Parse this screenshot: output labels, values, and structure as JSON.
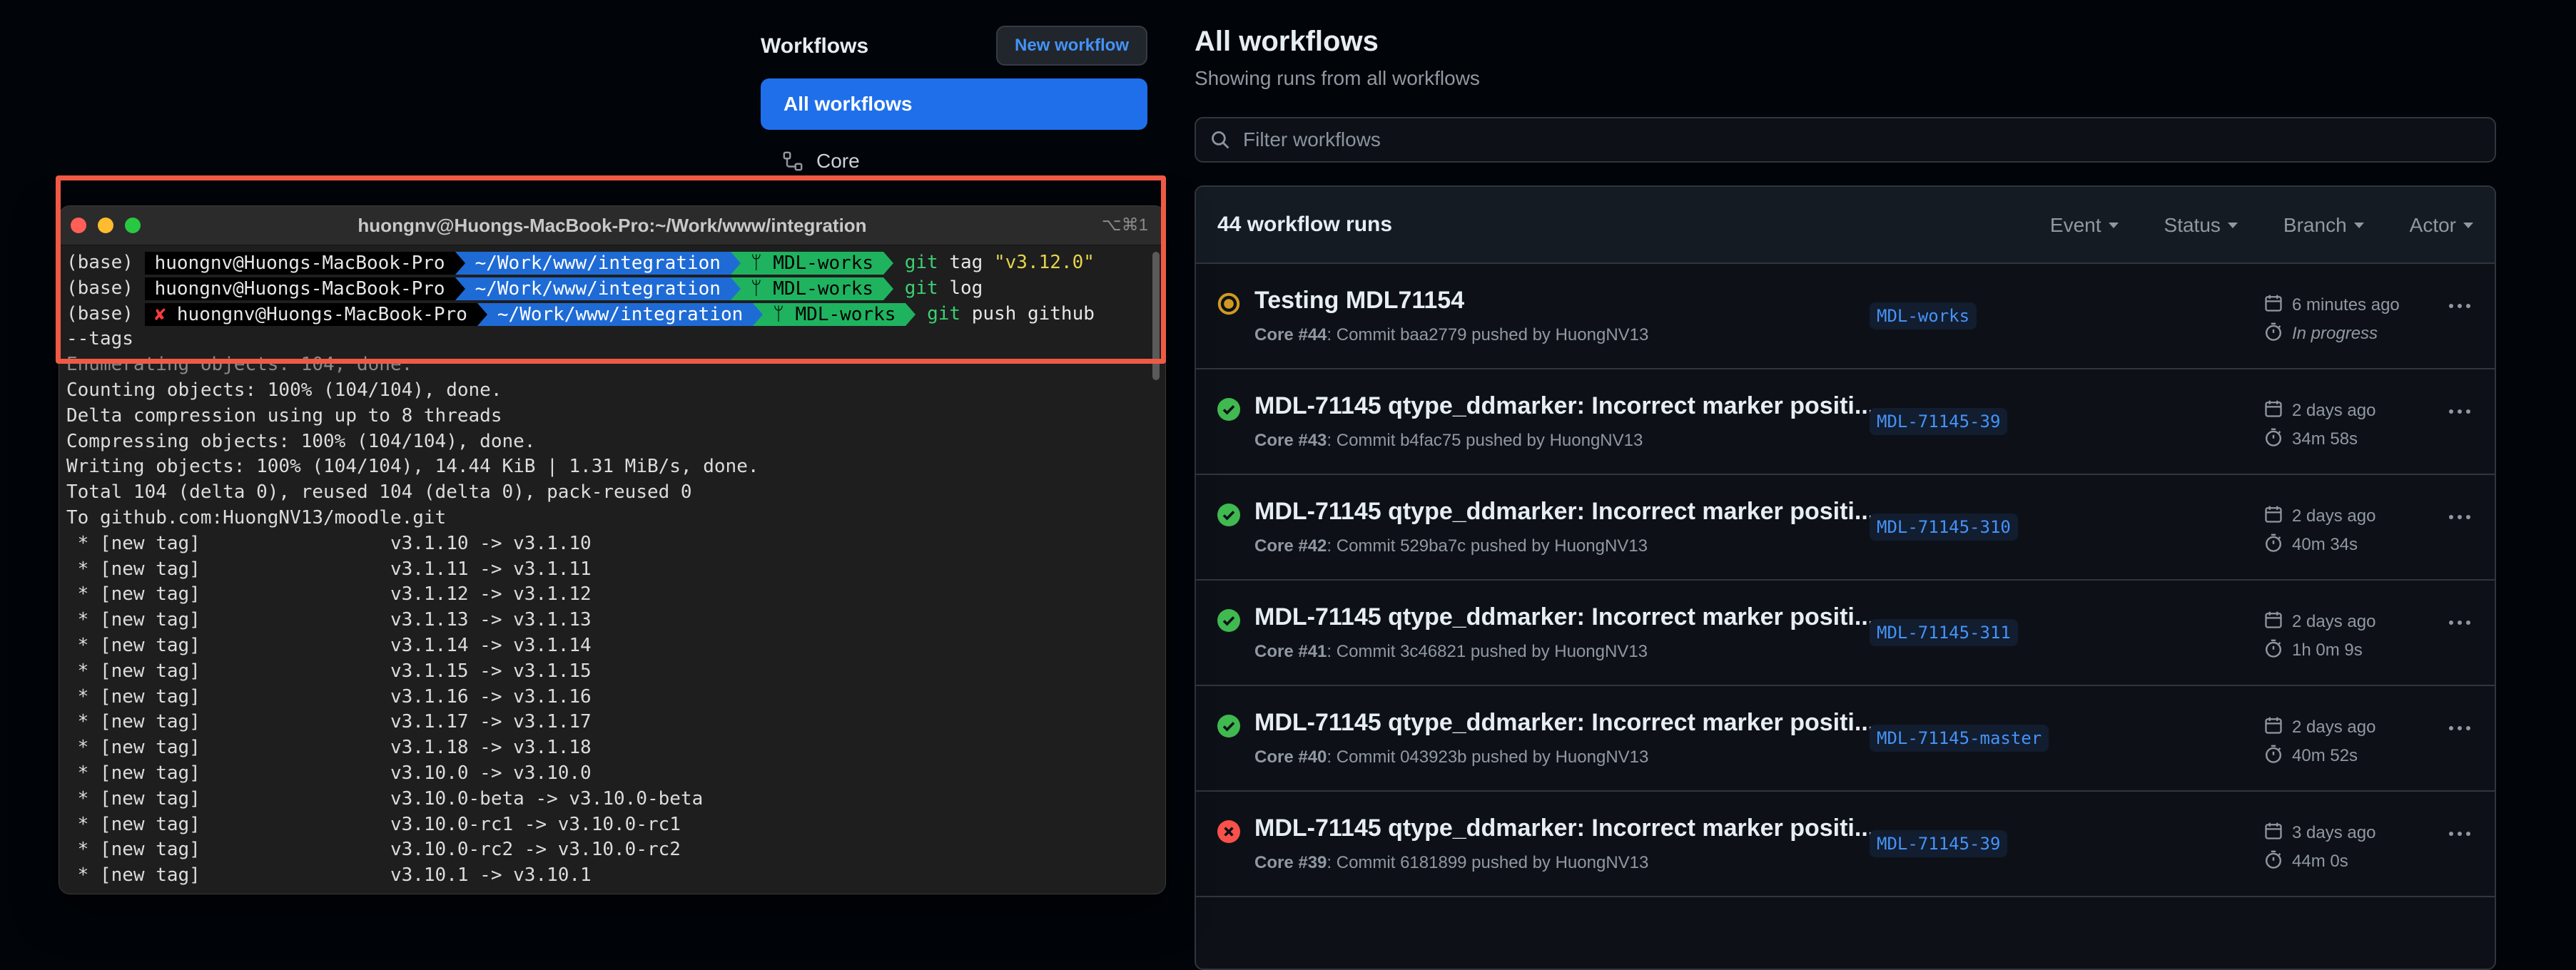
{
  "sidebar": {
    "title": "Workflows",
    "new_button": "New workflow",
    "items": [
      {
        "label": "All workflows"
      },
      {
        "label": "Core"
      }
    ]
  },
  "main": {
    "title": "All workflows",
    "subtitle": "Showing runs from all workflows",
    "filter_placeholder": "Filter workflows",
    "runs_count": "44 workflow runs",
    "filters": [
      "Event",
      "Status",
      "Branch",
      "Actor"
    ],
    "runs": [
      {
        "status": "in_progress",
        "title": "Testing MDL71154",
        "workflow": "Core",
        "number": "#44",
        "detail": ": Commit baa2779 pushed by HuongNV13",
        "branch": "MDL-works",
        "date": "6 minutes ago",
        "duration": "In progress"
      },
      {
        "status": "success",
        "title": "MDL-71145 qtype_ddmarker: Incorrect marker positi...",
        "workflow": "Core",
        "number": "#43",
        "detail": ": Commit b4fac75 pushed by HuongNV13",
        "branch": "MDL-71145-39",
        "date": "2 days ago",
        "duration": "34m 58s"
      },
      {
        "status": "success",
        "title": "MDL-71145 qtype_ddmarker: Incorrect marker positi...",
        "workflow": "Core",
        "number": "#42",
        "detail": ": Commit 529ba7c pushed by HuongNV13",
        "branch": "MDL-71145-310",
        "date": "2 days ago",
        "duration": "40m 34s"
      },
      {
        "status": "success",
        "title": "MDL-71145 qtype_ddmarker: Incorrect marker positi...",
        "workflow": "Core",
        "number": "#41",
        "detail": ": Commit 3c46821 pushed by HuongNV13",
        "branch": "MDL-71145-311",
        "date": "2 days ago",
        "duration": "1h 0m 9s"
      },
      {
        "status": "success",
        "title": "MDL-71145 qtype_ddmarker: Incorrect marker positi...",
        "workflow": "Core",
        "number": "#40",
        "detail": ": Commit 043923b pushed by HuongNV13",
        "branch": "MDL-71145-master",
        "date": "2 days ago",
        "duration": "40m 52s"
      },
      {
        "status": "failure",
        "title": "MDL-71145 qtype_ddmarker: Incorrect marker positi...",
        "workflow": "Core",
        "number": "#39",
        "detail": ": Commit 6181899 pushed by HuongNV13",
        "branch": "MDL-71145-39",
        "date": "3 days ago",
        "duration": "44m 0s"
      }
    ]
  },
  "terminal": {
    "title": "huongnv@Huongs-MacBook-Pro:~/Work/www/integration",
    "shortcut": "⌥⌘1",
    "prompts": [
      {
        "env": "(base)",
        "error": "",
        "user": "huongnv@Huongs-MacBook-Pro",
        "path": "~/Work/www/integration",
        "branch": "ᛘ MDL-works",
        "cmd": "git",
        "args": "tag",
        "str": "\"v3.12.0\""
      },
      {
        "env": "(base)",
        "error": "",
        "user": "huongnv@Huongs-MacBook-Pro",
        "path": "~/Work/www/integration",
        "branch": "ᛘ MDL-works",
        "cmd": "git",
        "args": "log",
        "str": ""
      },
      {
        "env": "(base)",
        "error": "✘",
        "user": "huongnv@Huongs-MacBook-Pro",
        "path": "~/Work/www/integration",
        "branch": "ᛘ MDL-works",
        "cmd": "git",
        "args": "push github",
        "str": ""
      }
    ],
    "cont": "--tags",
    "output": [
      "Enumerating objects: 104, done.",
      "Counting objects: 100% (104/104), done.",
      "Delta compression using up to 8 threads",
      "Compressing objects: 100% (104/104), done.",
      "Writing objects: 100% (104/104), 14.44 KiB | 1.31 MiB/s, done.",
      "Total 104 (delta 0), reused 104 (delta 0), pack-reused 0",
      "To github.com:HuongNV13/moodle.git",
      " * [new tag]                 v3.1.10 -> v3.1.10",
      " * [new tag]                 v3.1.11 -> v3.1.11",
      " * [new tag]                 v3.1.12 -> v3.1.12",
      " * [new tag]                 v3.1.13 -> v3.1.13",
      " * [new tag]                 v3.1.14 -> v3.1.14",
      " * [new tag]                 v3.1.15 -> v3.1.15",
      " * [new tag]                 v3.1.16 -> v3.1.16",
      " * [new tag]                 v3.1.17 -> v3.1.17",
      " * [new tag]                 v3.1.18 -> v3.1.18",
      " * [new tag]                 v3.10.0 -> v3.10.0",
      " * [new tag]                 v3.10.0-beta -> v3.10.0-beta",
      " * [new tag]                 v3.10.0-rc1 -> v3.10.0-rc1",
      " * [new tag]                 v3.10.0-rc2 -> v3.10.0-rc2",
      " * [new tag]                 v3.10.1 -> v3.10.1"
    ]
  },
  "colors": {
    "accent": "#1f6feb",
    "success": "#3fb950",
    "in_progress": "#d29922",
    "failure": "#f85149",
    "highlight": "#ef5a45"
  }
}
